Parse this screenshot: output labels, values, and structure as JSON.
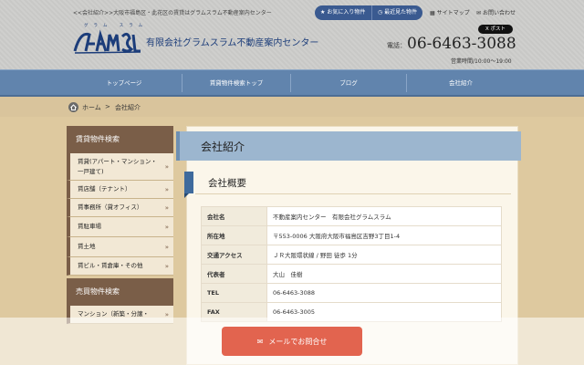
{
  "header": {
    "tagline": "<<会社紹介>>大阪市福島区・此花区の賃貸はグラムスラム不動産案内センター",
    "logo_text": "GRAM SLAM",
    "logo_ruby": "グラム スラム",
    "company_name": "有限会社グラムスラム不動産案内センター",
    "favorites_label": "お気に入り物件",
    "recent_label": "最近見た物件",
    "sitemap_label": "サイトマップ",
    "contact_label": "お問い合わせ",
    "xpost_label": "X ポスト",
    "tel_label": "電話：",
    "tel_number": "06-6463-3088",
    "hours": "営業時間/10:00～19:00"
  },
  "nav": {
    "items": [
      "トップページ",
      "賃貸物件検索トップ",
      "ブログ",
      "会社紹介"
    ]
  },
  "breadcrumb": {
    "home": "ホーム",
    "separator": ">",
    "current": "会社紹介"
  },
  "sidebar": {
    "rent_heading": "賃貸物件検索",
    "rent_items": [
      "賃貸(アパート・マンション・一戸建て)",
      "賃店舗（テナント）",
      "賃事務所（貸オフィス）",
      "賃駐車場",
      "賃土地",
      "賃ビル・賃倉庫・その他"
    ],
    "sale_heading": "売買物件検索",
    "sale_items": [
      "マンション（新築・分譲・"
    ]
  },
  "main": {
    "page_title": "会社紹介",
    "section_title": "会社概要",
    "info_rows": [
      {
        "key": "会社名",
        "value": "不動産案内センター　有限会社グラムスラム"
      },
      {
        "key": "所在地",
        "value": "〒553-0006 大阪府大阪市福島区吉野3丁目1-4"
      },
      {
        "key": "交通アクセス",
        "value": "ＪＲ大阪環状線 / 野田 徒歩 1分"
      },
      {
        "key": "代表者",
        "value": "大山　佳樹"
      },
      {
        "key": "TEL",
        "value": "06-6463-3088"
      },
      {
        "key": "FAX",
        "value": "06-6463-3005"
      }
    ]
  },
  "cta": {
    "label": "メールでお問合せ"
  },
  "colors": {
    "nav": "#6184ad",
    "sidebar_head": "#7a5e48",
    "cta": "#e2644f",
    "brand_blue": "#1c3d7a"
  }
}
